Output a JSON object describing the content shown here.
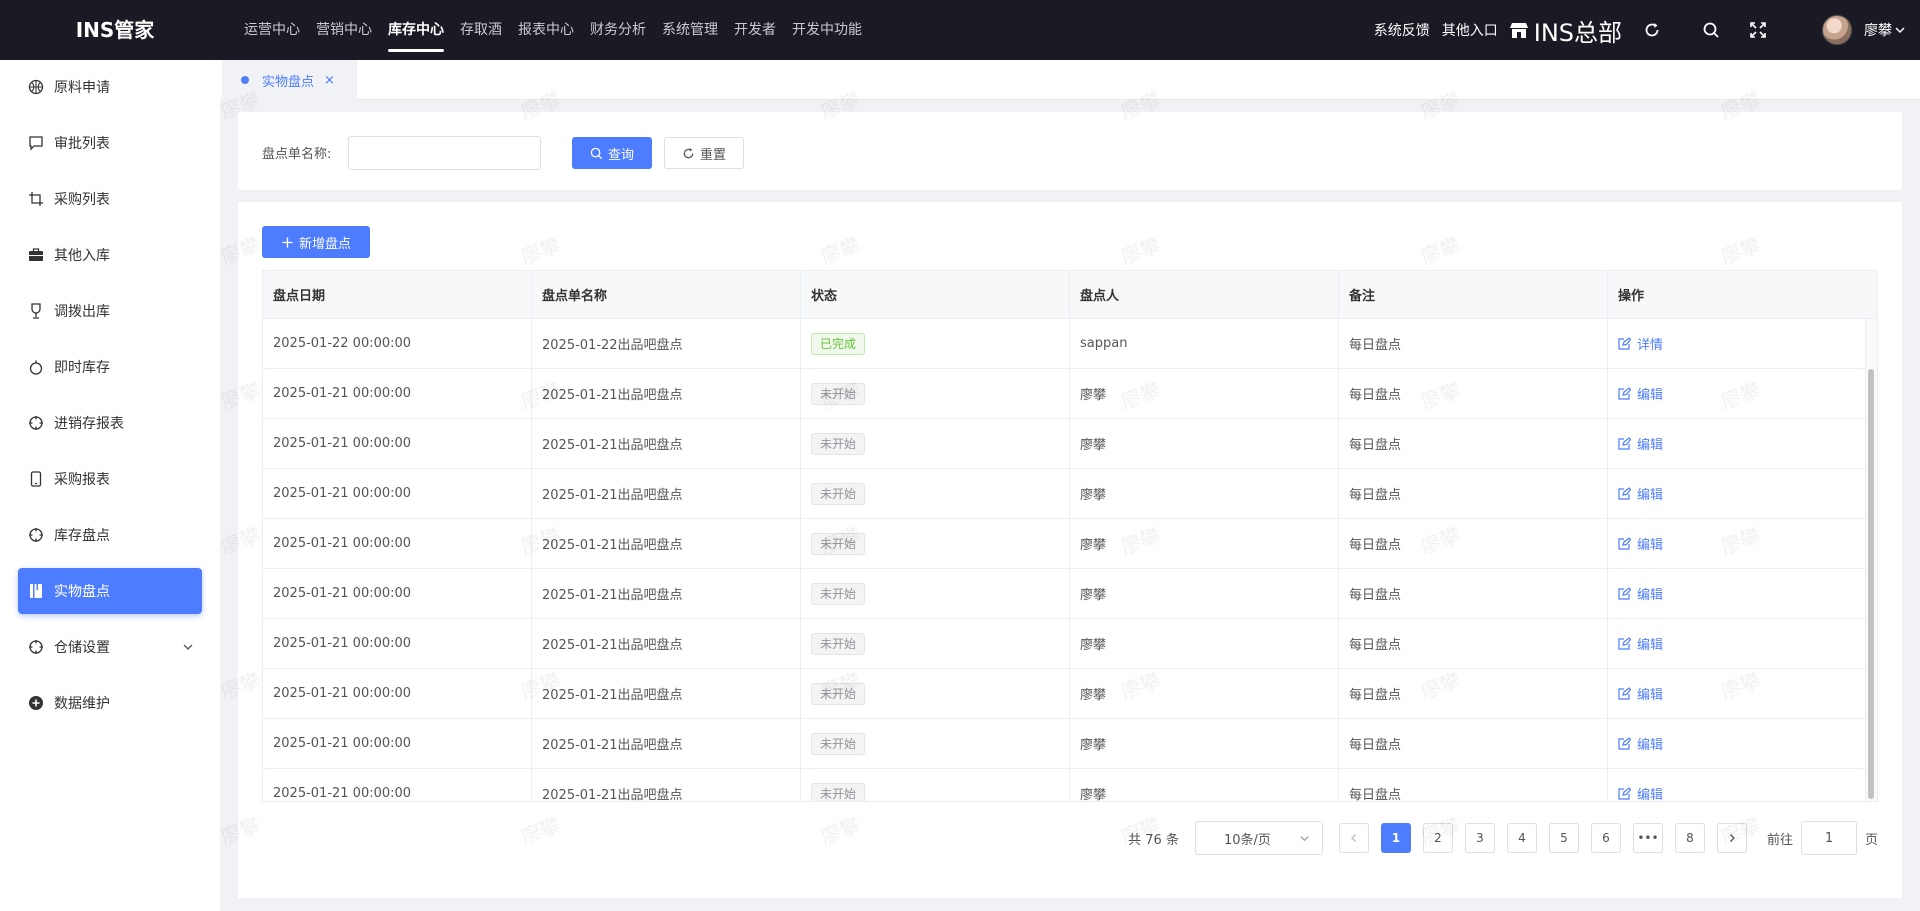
{
  "app": {
    "brand": "INS管家"
  },
  "topnav": {
    "items": [
      {
        "label": "运营中心"
      },
      {
        "label": "营销中心"
      },
      {
        "label": "库存中心"
      },
      {
        "label": "存取酒"
      },
      {
        "label": "报表中心"
      },
      {
        "label": "财务分析"
      },
      {
        "label": "系统管理"
      },
      {
        "label": "开发者"
      },
      {
        "label": "开发中功能"
      }
    ],
    "active": "库存中心"
  },
  "header": {
    "feedback": "系统反馈",
    "other_entry": "其他入口",
    "store_name": "INS总部",
    "user_name": "廖攀",
    "icons": [
      "refresh-icon",
      "search-icon",
      "fullscreen-icon"
    ]
  },
  "sidebar": {
    "items": [
      {
        "label": "原料申请",
        "icon": "basketball-icon"
      },
      {
        "label": "审批列表",
        "icon": "message-icon"
      },
      {
        "label": "采购列表",
        "icon": "crop-icon"
      },
      {
        "label": "其他入库",
        "icon": "briefcase-icon"
      },
      {
        "label": "调拨出库",
        "icon": "trophy-icon"
      },
      {
        "label": "即时库存",
        "icon": "apple-icon"
      },
      {
        "label": "进销存报表",
        "icon": "aim-icon"
      },
      {
        "label": "采购报表",
        "icon": "mobile-icon"
      },
      {
        "label": "库存盘点",
        "icon": "aim-icon"
      },
      {
        "label": "实物盘点",
        "icon": "notebook-icon",
        "active": true
      },
      {
        "label": "仓储设置",
        "icon": "aim-icon",
        "expandable": true
      },
      {
        "label": "数据维护",
        "icon": "circle-plus-icon"
      }
    ]
  },
  "tabs": [
    {
      "label": "实物盘点",
      "close": "×"
    }
  ],
  "search": {
    "label": "盘点单名称:",
    "input_value": "",
    "query_label": "查询",
    "reset_label": "重置"
  },
  "toolbar": {
    "add_label": "新增盘点"
  },
  "table": {
    "columns": [
      "盘点日期",
      "盘点单名称",
      "状态",
      "盘点人",
      "备注",
      "操作"
    ],
    "rows": [
      {
        "date": "2025-01-22 00:00:00",
        "name": "2025-01-22出品吧盘点",
        "status": "已完成",
        "status_type": "done",
        "person": "sappan",
        "remark": "每日盘点",
        "action": "详情"
      },
      {
        "date": "2025-01-21 00:00:00",
        "name": "2025-01-21出品吧盘点",
        "status": "未开始",
        "status_type": "todo",
        "person": "廖攀",
        "remark": "每日盘点",
        "action": "编辑"
      },
      {
        "date": "2025-01-21 00:00:00",
        "name": "2025-01-21出品吧盘点",
        "status": "未开始",
        "status_type": "todo",
        "person": "廖攀",
        "remark": "每日盘点",
        "action": "编辑"
      },
      {
        "date": "2025-01-21 00:00:00",
        "name": "2025-01-21出品吧盘点",
        "status": "未开始",
        "status_type": "todo",
        "person": "廖攀",
        "remark": "每日盘点",
        "action": "编辑"
      },
      {
        "date": "2025-01-21 00:00:00",
        "name": "2025-01-21出品吧盘点",
        "status": "未开始",
        "status_type": "todo",
        "person": "廖攀",
        "remark": "每日盘点",
        "action": "编辑"
      },
      {
        "date": "2025-01-21 00:00:00",
        "name": "2025-01-21出品吧盘点",
        "status": "未开始",
        "status_type": "todo",
        "person": "廖攀",
        "remark": "每日盘点",
        "action": "编辑"
      },
      {
        "date": "2025-01-21 00:00:00",
        "name": "2025-01-21出品吧盘点",
        "status": "未开始",
        "status_type": "todo",
        "person": "廖攀",
        "remark": "每日盘点",
        "action": "编辑"
      },
      {
        "date": "2025-01-21 00:00:00",
        "name": "2025-01-21出品吧盘点",
        "status": "未开始",
        "status_type": "todo",
        "person": "廖攀",
        "remark": "每日盘点",
        "action": "编辑"
      },
      {
        "date": "2025-01-21 00:00:00",
        "name": "2025-01-21出品吧盘点",
        "status": "未开始",
        "status_type": "todo",
        "person": "廖攀",
        "remark": "每日盘点",
        "action": "编辑"
      },
      {
        "date": "2025-01-21 00:00:00",
        "name": "2025-01-21出品吧盘点",
        "status": "未开始",
        "status_type": "todo",
        "person": "廖攀",
        "remark": "每日盘点",
        "action": "编辑"
      }
    ]
  },
  "pagination": {
    "total": "共 76 条",
    "page_size": "10条/页",
    "pages": [
      "1",
      "2",
      "3",
      "4",
      "5",
      "6",
      "•••",
      "8"
    ],
    "current": "1",
    "goto_prefix": "前往",
    "goto_value": "1",
    "goto_suffix": "页"
  },
  "watermark": "廖攀",
  "colors": {
    "accent": "#4d7cfe",
    "topbar": "#191a23",
    "success": "#67c23a"
  }
}
